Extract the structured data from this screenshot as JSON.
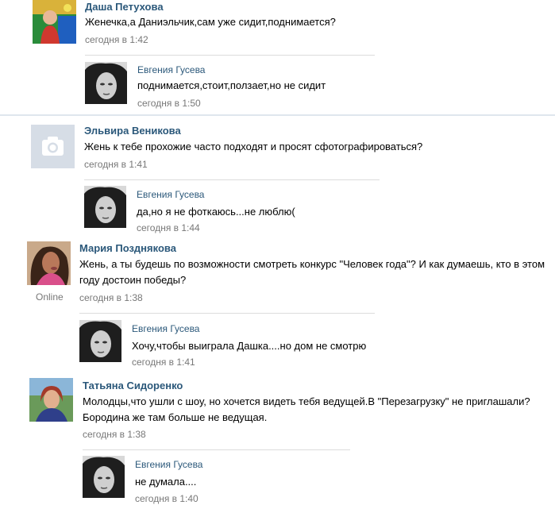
{
  "posts": [
    {
      "author": "Даша Петухова",
      "text": "Женечка,а Даниэльчик,сам уже сидит,поднимается?",
      "time": "сегодня в 1:42",
      "reply": {
        "author": "Евгения Гусева",
        "text": "поднимается,стоит,ползает,но не сидит",
        "time": "сегодня в 1:50"
      }
    },
    {
      "author": "Эльвира Веникова",
      "text": "Жень к тебе прохожие часто подходят и просят сфотографироваться?",
      "time": "сегодня в 1:41",
      "avatar_icon": "camera-icon",
      "reply": {
        "author": "Евгения Гусева",
        "text": "да,но я не фоткаюсь...не люблю(",
        "time": "сегодня в 1:44"
      }
    },
    {
      "author": "Мария Позднякова",
      "text_line1": "Жень, а ты будешь по возможности смотреть конкурс \"Человек года\"? И как думаешь, кто в этом",
      "text_line2": "году достоин победы?",
      "time": "сегодня в 1:38",
      "status": "Online",
      "reply": {
        "author": "Евгения Гусева",
        "text": "Хочу,чтобы выиграла Дашка....но дом не смотрю",
        "time": "сегодня в 1:41"
      }
    },
    {
      "author": "Татьяна Сидоренко",
      "text_line1": "Молодцы,что ушли с шоу, но хочется видеть тебя ведущей.В \"Перезагрузку\" не приглашали?",
      "text_line2": "Бородина же там больше не ведущая.",
      "time": "сегодня в 1:38",
      "reply": {
        "author": "Евгения Гусева",
        "text": "не думала....",
        "time": "сегодня в 1:40"
      }
    }
  ],
  "colors": {
    "author_link": "#2b587a",
    "timestamp": "#777777",
    "separator": "#dfe6ee"
  }
}
